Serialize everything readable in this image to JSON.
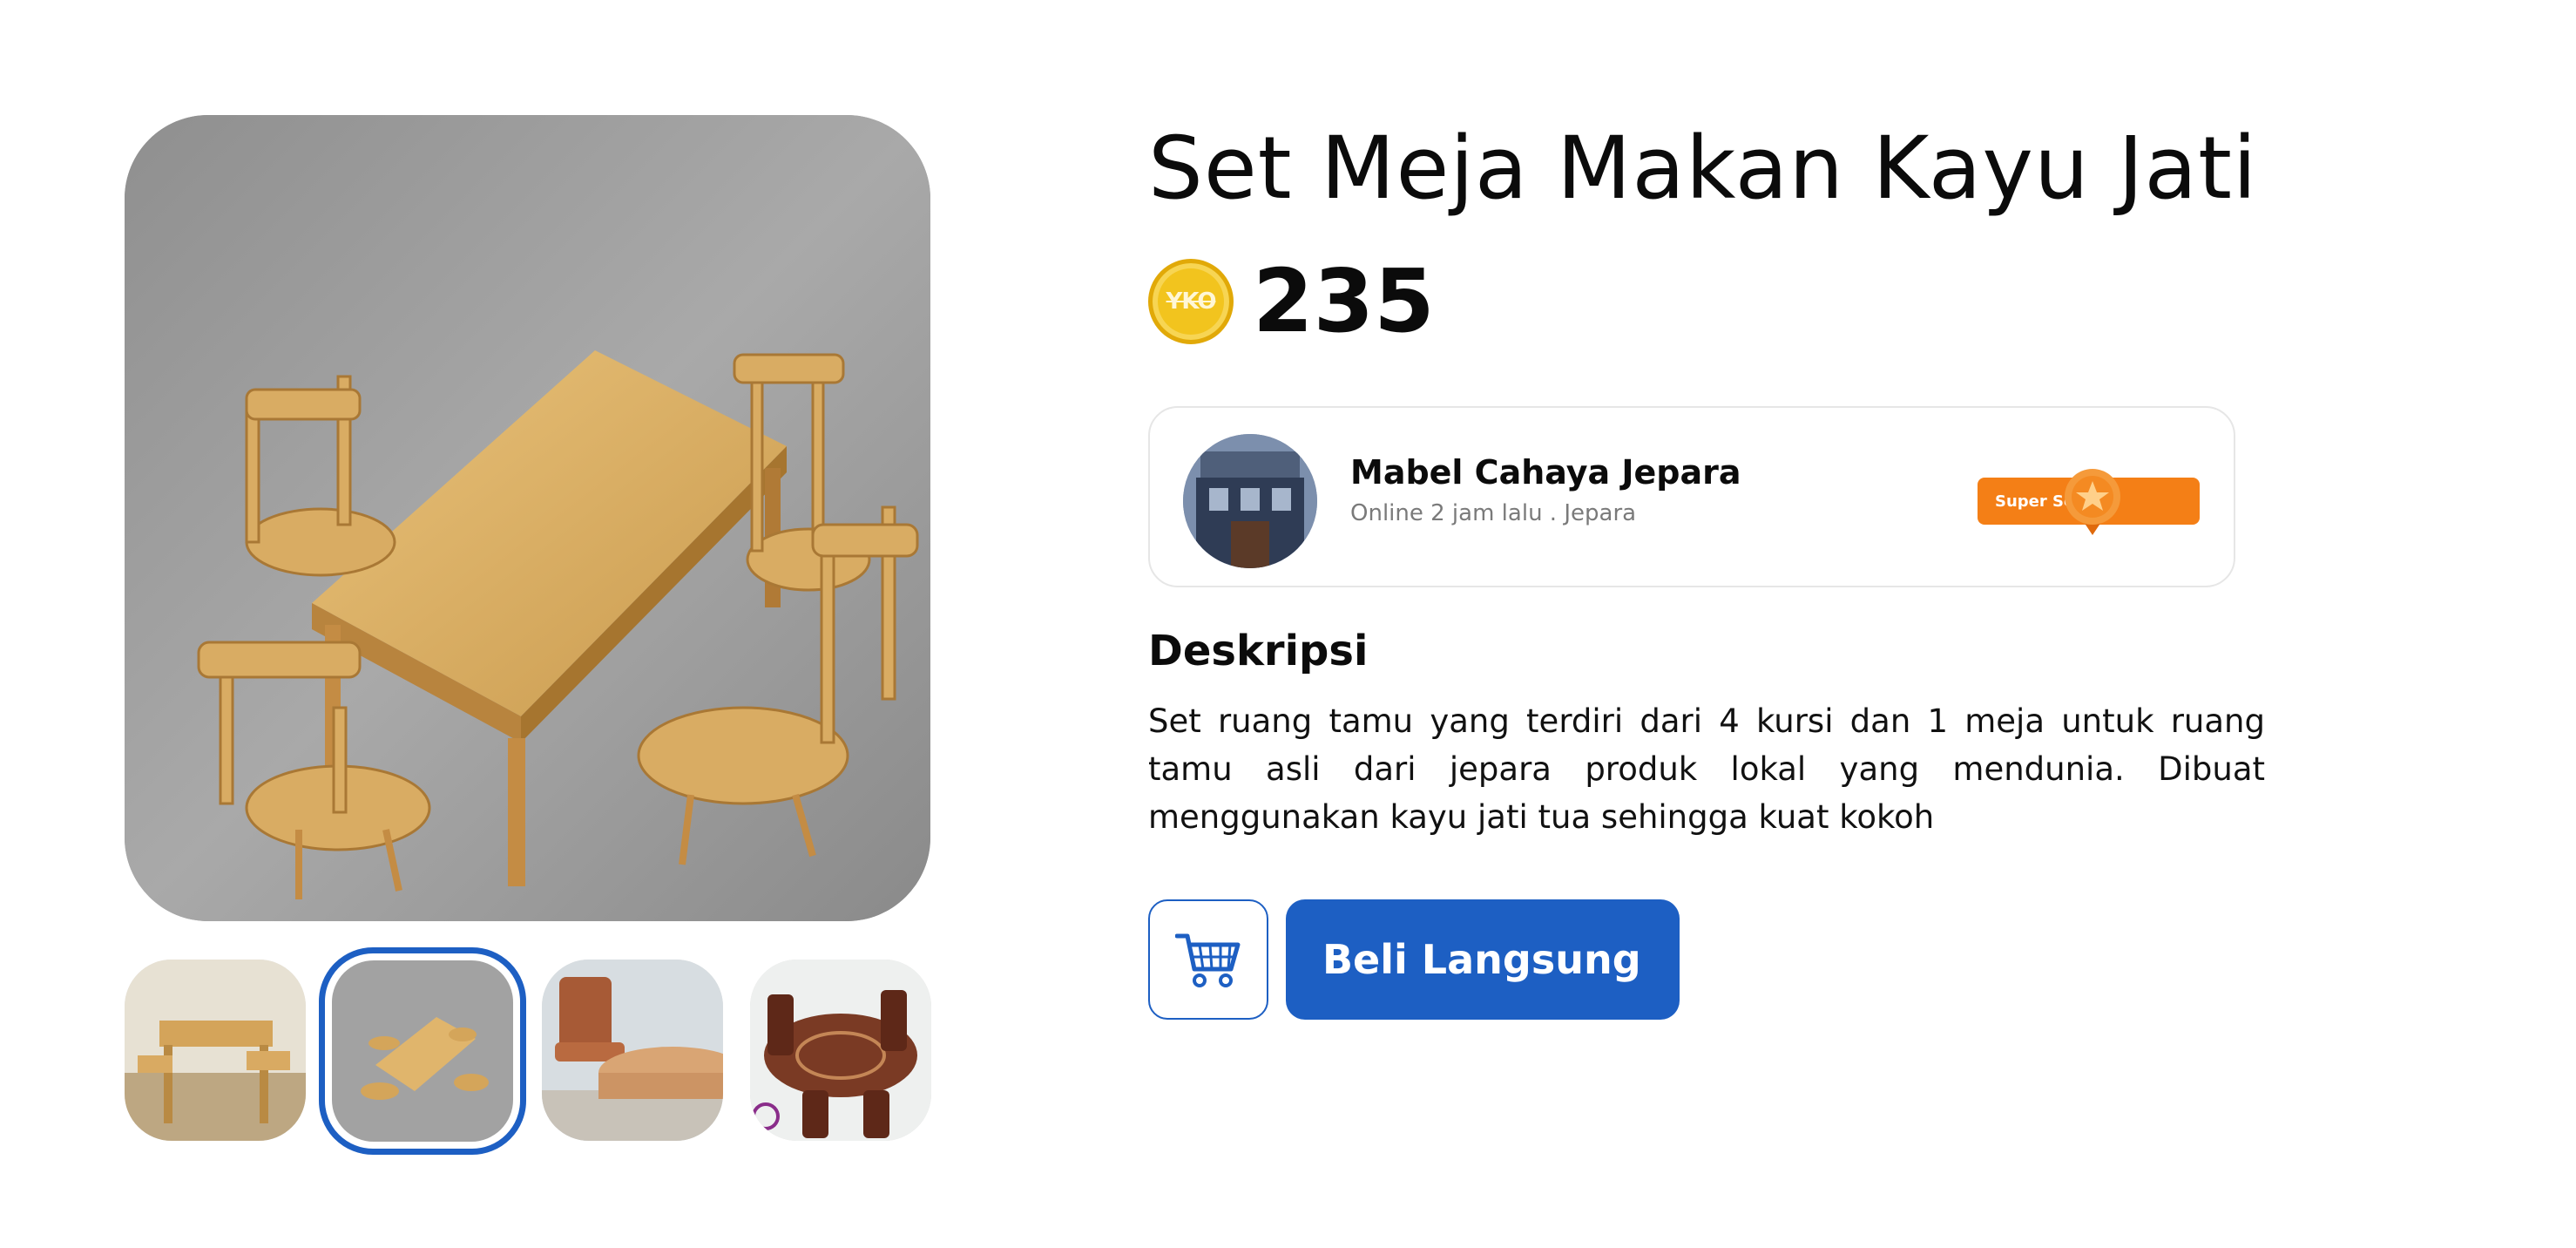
{
  "product": {
    "title": "Set Meja Makan Kayu Jati",
    "currency_icon_text": "YKO",
    "price": "235"
  },
  "seller": {
    "name": "Mabel Cahaya Jepara",
    "meta": "Online 2 jam lalu . Jepara",
    "badge": "Super Seller"
  },
  "description": {
    "heading": "Deskripsi",
    "text": "Set ruang tamu yang terdiri dari 4 kursi dan 1 meja untuk ruang tamu asli dari jepara produk lokal yang mendunia. Dibuat menggunakan kayu jati tua sehingga kuat kokoh"
  },
  "actions": {
    "buy_label": "Beli Langsung"
  },
  "gallery": {
    "selected_index": 1
  },
  "colors": {
    "primary": "#1d5fc3",
    "badge": "#f47f16",
    "coin": "#f2c41e"
  }
}
